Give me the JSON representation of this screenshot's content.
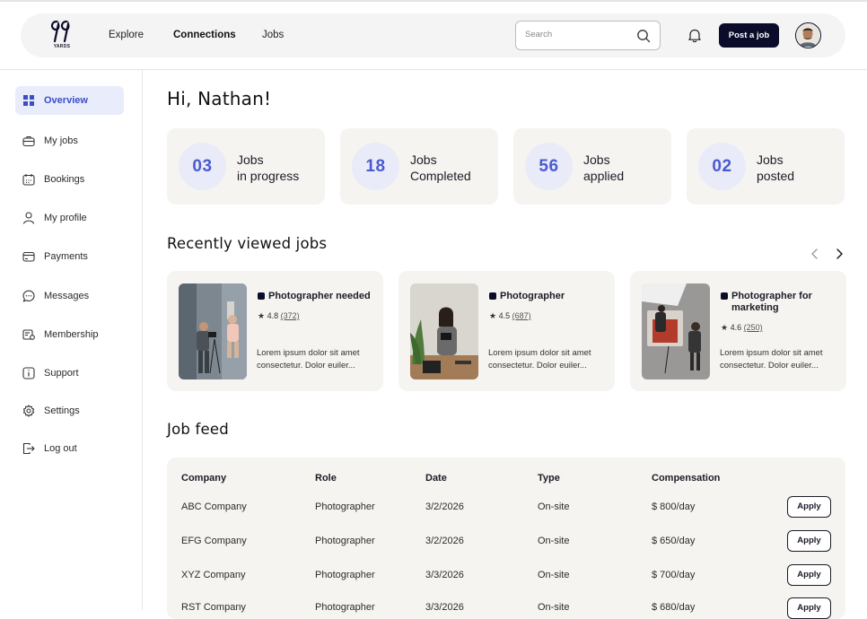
{
  "header": {
    "logo_text": "YARDS",
    "nav": [
      "Explore",
      "Connections",
      "Jobs"
    ],
    "search_placeholder": "Search",
    "post_job_label": "Post a job"
  },
  "sidebar": {
    "items": [
      {
        "label": "Overview",
        "icon": "grid-icon"
      },
      {
        "label": "My jobs",
        "icon": "briefcase-icon"
      },
      {
        "label": "Bookings",
        "icon": "calendar-icon"
      },
      {
        "label": "My profile",
        "icon": "user-icon"
      },
      {
        "label": "Payments",
        "icon": "card-icon"
      },
      {
        "label": "Messages",
        "icon": "chat-icon"
      },
      {
        "label": "Membership",
        "icon": "membership-icon"
      },
      {
        "label": "Support",
        "icon": "info-icon"
      },
      {
        "label": "Settings",
        "icon": "gear-icon"
      },
      {
        "label": "Log out",
        "icon": "logout-icon"
      }
    ]
  },
  "greeting": "Hi, Nathan!",
  "stats": [
    {
      "value": "03",
      "line1": "Jobs",
      "line2": "in progress"
    },
    {
      "value": "18",
      "line1": "Jobs",
      "line2": "Completed"
    },
    {
      "value": "56",
      "line1": "Jobs",
      "line2": "applied"
    },
    {
      "value": "02",
      "line1": "Jobs",
      "line2": "posted"
    }
  ],
  "recent": {
    "title": "Recently viewed jobs",
    "cards": [
      {
        "title": "Photographer needed",
        "rating": "4.8",
        "count": "(372)",
        "desc": "Lorem ipsum dolor sit amet consectetur. Dolor euiler..."
      },
      {
        "title": "Photographer",
        "rating": "4.5",
        "count": "(687)",
        "desc": "Lorem ipsum dolor sit amet consectetur. Dolor euiler..."
      },
      {
        "title": "Photographer for marketing",
        "rating": "4.6",
        "count": "(250)",
        "desc": "Lorem ipsum dolor sit amet consectetur. Dolor euiler..."
      }
    ]
  },
  "feed": {
    "title": "Job feed",
    "columns": [
      "Company",
      "Role",
      "Date",
      "Type",
      "Compensation"
    ],
    "apply_label": "Apply",
    "rows": [
      [
        "ABC Company",
        "Photographer",
        "3/2/2026",
        "On-site",
        "$ 800/day"
      ],
      [
        "EFG Company",
        "Photographer",
        "3/2/2026",
        "On-site",
        "$ 650/day"
      ],
      [
        "XYZ Company",
        "Photographer",
        "3/3/2026",
        "On-site",
        "$ 700/day"
      ],
      [
        "RST Company",
        "Photographer",
        "3/3/2026",
        "On-site",
        "$ 680/day"
      ]
    ]
  },
  "colors": {
    "accent": "#4a5bd0",
    "accent_bg": "#e9ebf9",
    "card_bg": "#f5f4f0",
    "dark": "#0b0b2a"
  }
}
